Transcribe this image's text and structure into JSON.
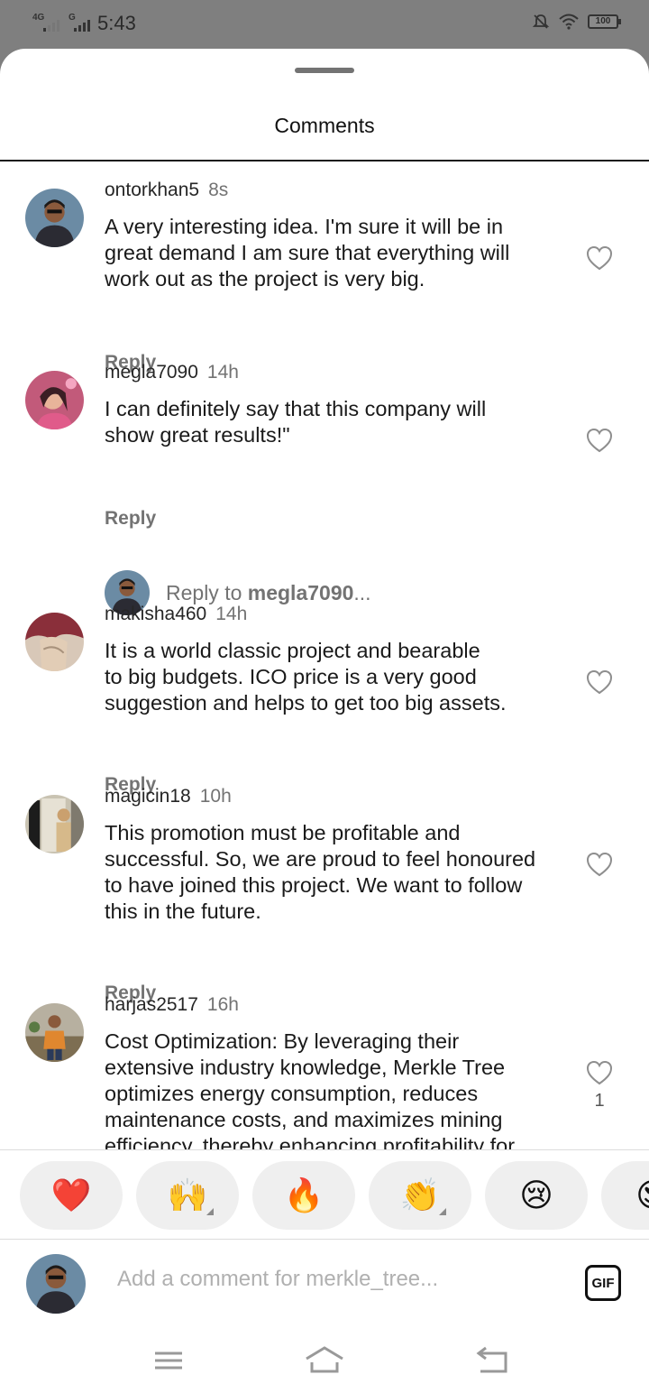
{
  "status_bar": {
    "network_1": "4G",
    "network_2": "G",
    "time": "5:43",
    "battery": "100",
    "icons": [
      "silent-bell-icon",
      "wifi-icon",
      "battery-icon"
    ]
  },
  "sheet": {
    "title": "Comments"
  },
  "comments": [
    {
      "username": "ontorkhan5",
      "time": "8s",
      "text": "A very interesting idea. I'm sure it will be in\ngreat demand I am sure that everything will\nwork out as the project is very big.",
      "reply_label": "Reply",
      "avatar_bg": "#6b8ba4"
    },
    {
      "username": "megla7090",
      "time": "14h",
      "text": "I can definitely say that this company will\nshow great results!\"",
      "reply_label": "Reply",
      "avatar_bg": "#c25a7a"
    },
    {
      "username": "makisha460",
      "time": "14h",
      "text": "It is a world classic project and bearable\nto big budgets. ICO price is a very good\nsuggestion and helps to get too big assets.",
      "reply_label": "Reply",
      "avatar_bg": "#8a2f3a"
    },
    {
      "username": "magicin18",
      "time": "10h",
      "text": "This promotion must be profitable and\nsuccessful. So, we are proud to feel honoured\nto have joined this project. We want to follow\nthis in the future.",
      "reply_label": "Reply",
      "avatar_bg": "#c9c3b2"
    },
    {
      "username": "harjas2517",
      "time": "16h",
      "text": "Cost Optimization: By leveraging their\nextensive industry knowledge, Merkle Tree\noptimizes energy consumption, reduces\nmaintenance costs, and maximizes mining\nefficiency, thereby enhancing profitability for",
      "like_count": "1",
      "avatar_bg": "#9a7d5a"
    }
  ],
  "reply_to": {
    "prefix": "Reply to ",
    "username": "megla7090",
    "suffix": "..."
  },
  "emoji_bar": [
    "❤️",
    "🙌",
    "🔥",
    "👏",
    "😢",
    "😍"
  ],
  "composer": {
    "placeholder": "Add a comment for merkle_tree...",
    "gif_label": "GIF"
  },
  "nav_bar": [
    "menu-icon",
    "home-icon",
    "back-icon"
  ]
}
